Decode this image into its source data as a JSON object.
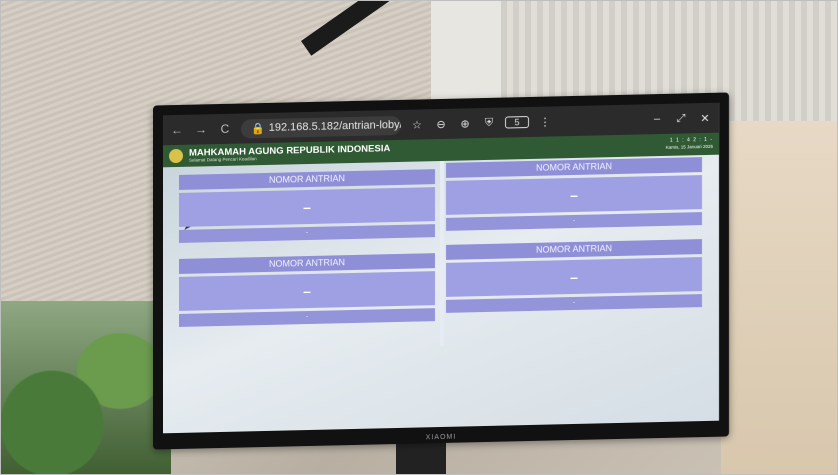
{
  "browser": {
    "url": "192.168.5.182/antrian-loby/d...",
    "tab_count": "5"
  },
  "app": {
    "title": "MAHKAMAH AGUNG REPUBLIK INDONESIA",
    "subtitle": "Selamat Datang Pencari Keadilan",
    "clock": "1 1 : 4 2 : 1 -",
    "date": "Kamis, 15 Januari 2026"
  },
  "panels": [
    {
      "label": "NOMOR ANTRIAN",
      "number": "–",
      "footer": "-"
    },
    {
      "label": "NOMOR ANTRIAN",
      "number": "–",
      "footer": "-"
    },
    {
      "label": "NOMOR ANTRIAN",
      "number": "–",
      "footer": "-"
    },
    {
      "label": "NOMOR ANTRIAN",
      "number": "–",
      "footer": "-"
    }
  ],
  "tv_brand": "XIAOMI",
  "colors": {
    "header_green": "#2f5a34",
    "panel_purple": "#9f9fe3"
  },
  "icons": [
    "back-arrow-icon",
    "forward-arrow-icon",
    "reload-icon",
    "lock-icon",
    "star-icon",
    "zoom-out-icon",
    "zoom-in-icon",
    "shield-icon",
    "more-vert-icon",
    "minimize-icon",
    "restore-icon",
    "close-icon",
    "cursor-icon"
  ]
}
